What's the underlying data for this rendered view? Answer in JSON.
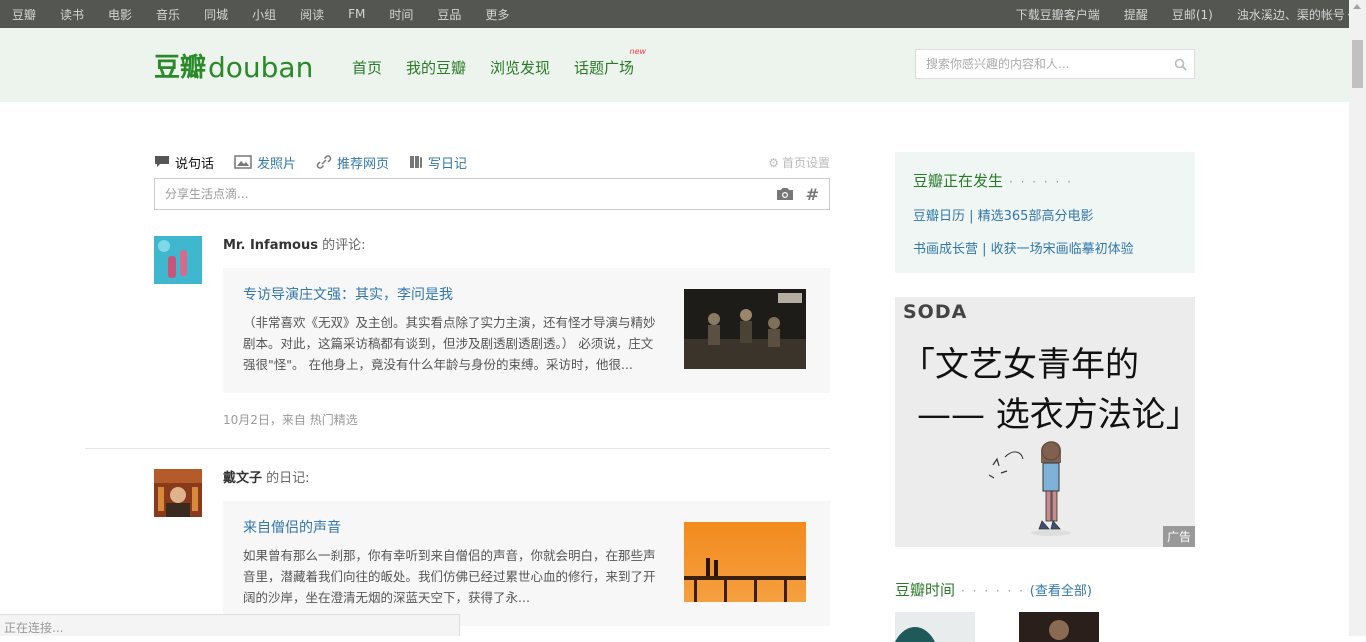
{
  "topbar": {
    "left": [
      "豆瓣",
      "读书",
      "电影",
      "音乐",
      "同城",
      "小组",
      "阅读",
      "FM",
      "时间",
      "豆品",
      "更多"
    ],
    "right": [
      "下载豆瓣客户端",
      "提醒",
      "豆邮(1)",
      "浊水溪边、渠的帐号"
    ]
  },
  "logo": {
    "cn": "豆瓣",
    "en": "douban"
  },
  "nav": {
    "items": [
      "首页",
      "我的豆瓣",
      "浏览发现",
      "话题广场"
    ],
    "badge": "new"
  },
  "search": {
    "placeholder": "搜索你感兴趣的内容和人..."
  },
  "composer": {
    "tabs": [
      "说句话",
      "发照片",
      "推荐网页",
      "写日记"
    ],
    "settings": "首页设置",
    "placeholder": "分享生活点滴..."
  },
  "feed": [
    {
      "author": "Mr. Infamous",
      "action": "的评论:",
      "title": "专访导演庄文强：其实，李问是我",
      "abstract": "（非常喜欢《无双》及主创。其实看点除了实力主演，还有怪才导演与精妙剧本。对此，这篇采访稿都有谈到，但涉及剧透剧透剧透。） 必须说，庄文强很\"怪\"。 在他身上，竟没有什么年龄与身份的束缚。采访时，他很...",
      "meta": "10月2日，来自 热门精选"
    },
    {
      "author": "戴文子",
      "action": "的日记:",
      "title": "来自僧侣的声音",
      "abstract": "如果曾有那么一刹那，你有幸听到来自僧侣的声音，你就会明白，在那些声音里，潜藏着我们向往的皈处。我们仿佛已经过累世心血的修行，来到了开阔的沙岸，坐在澄清无烟的深蓝天空下，获得了永..."
    }
  ],
  "aside": {
    "happening_title": "豆瓣正在发生",
    "happening_dots": "· · · · · ·",
    "links": [
      "豆瓣日历 | 精选365部高分电影",
      "书画成长营 | 收获一场宋画临摹初体验"
    ],
    "ad": {
      "brand": "SODA",
      "line1": "「文艺女青年的",
      "line2": "—— 选衣方法论」",
      "label": "广告"
    },
    "time_title": "豆瓣时间",
    "time_dots": "· · · · · ·",
    "time_open": "(",
    "time_all": "查看全部",
    "time_close": ")"
  },
  "status": "正在连接..."
}
